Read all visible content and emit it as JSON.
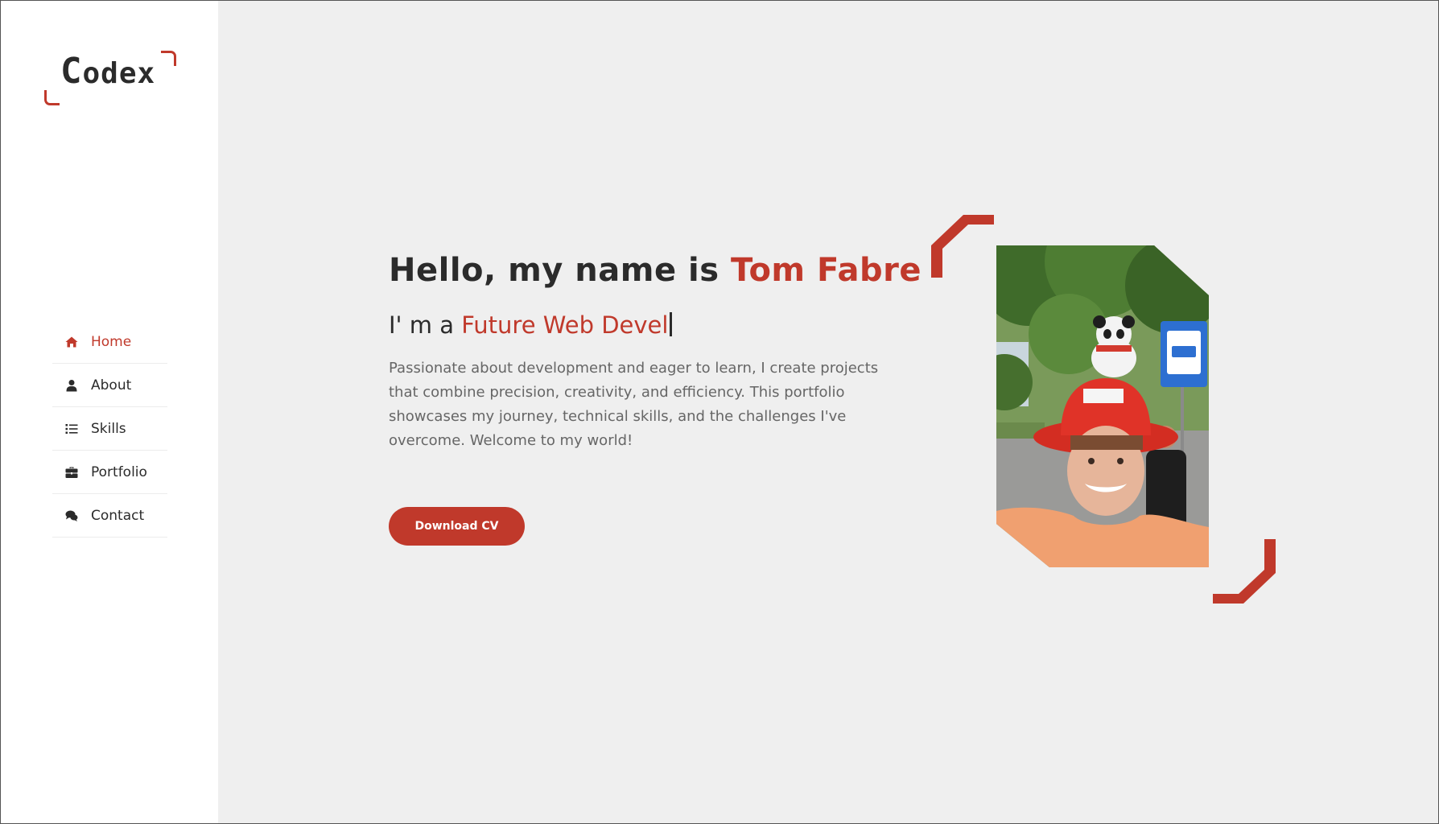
{
  "brand": {
    "logo_first": "C",
    "logo_rest": "odex",
    "accent_color": "#c0392b"
  },
  "nav": [
    {
      "label": "Home",
      "icon": "home-icon",
      "active": true
    },
    {
      "label": "About",
      "icon": "user-icon",
      "active": false
    },
    {
      "label": "Skills",
      "icon": "list-icon",
      "active": false
    },
    {
      "label": "Portfolio",
      "icon": "briefcase-icon",
      "active": false
    },
    {
      "label": "Contact",
      "icon": "comments-icon",
      "active": false
    }
  ],
  "hero": {
    "greeting": "Hello, my name is ",
    "name": "Tom Fabre",
    "role_prefix": "I' m a ",
    "role_typed": "Future Web Devel",
    "description": "Passionate about development and eager to learn, I create projects that combine precision, creativity, and efficiency. This portfolio showcases my journey, technical skills, and the challenges I've overcome. Welcome to my world!",
    "cta_label": "Download CV"
  },
  "controls": {
    "settings_icon": "gear-icon",
    "theme_icon": "moon-icon"
  }
}
